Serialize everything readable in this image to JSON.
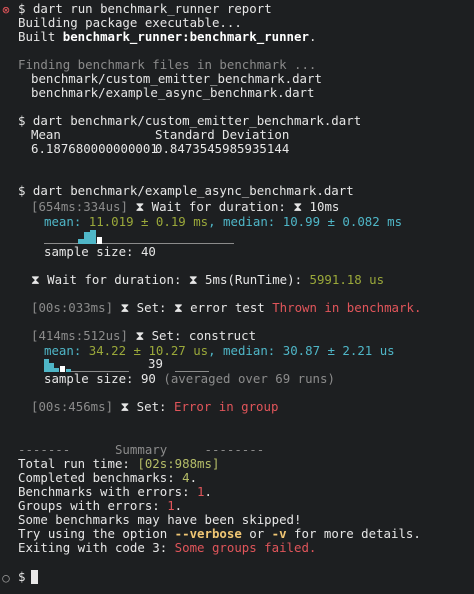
{
  "line1": {
    "prompt": "$",
    "command": "dart run benchmark_runner report"
  },
  "line2": "Building package executable...",
  "line3": {
    "prefix": "Built ",
    "target": "benchmark_runner:benchmark_runner",
    "suffix": "."
  },
  "finding": "Finding benchmark files in benchmark ...",
  "files": [
    "benchmark/custom_emitter_benchmark.dart",
    "benchmark/example_async_benchmark.dart"
  ],
  "cmd2": "$ dart benchmark/custom_emitter_benchmark.dart",
  "table": {
    "h1": "Mean",
    "h2": "Standard Deviation",
    "v1": "6.187680000000001",
    "v2": "0.8473545985935144"
  },
  "cmd3": "$ dart benchmark/example_async_benchmark.dart",
  "b1": {
    "time": "[654ms:334us]",
    "hourglass": "⧗",
    "name": " Wait for duration: ",
    "hourglass2": "⧗",
    "param": " 10ms",
    "mean_label": "mean: ",
    "mean_val": "11.019 ± 0.19 ms",
    "median_label": ", median: ",
    "median_val": "10.99 ± 0.082 ms",
    "sample": "sample size: 40"
  },
  "b2": {
    "prefix": "⧗ Wait for duration: ⧗ 5ms(RunTime): ",
    "val": "5991.18 us"
  },
  "b3": {
    "time": "[00s:033ms]",
    "label": " ⧗ Set: ⧗ error test ",
    "error": "Thrown in benchmark."
  },
  "b4": {
    "time": "[414ms:512us]",
    "label": " ⧗ Set: construct",
    "mean_label": "mean: ",
    "mean_val": "34.22 ± 10.27 us",
    "median_label": ", median: ",
    "median_val": "30.87 ± 2.21 us",
    "spark_num": "39",
    "sample": "sample size: 90",
    "sample_note": " (averaged over 69 runs)"
  },
  "b5": {
    "time": "[00s:456ms]",
    "label": " ⧗ Set: ",
    "error": "Error in group"
  },
  "summary": {
    "header": "-------      Summary     --------",
    "total_label": "Total run time: ",
    "total_val": "[02s:988ms]",
    "completed_label": "Completed benchmarks: ",
    "completed_val": "4",
    "errors_label": "Benchmarks with errors: ",
    "errors_val": "1",
    "groups_label": "Groups with errors: ",
    "groups_val": "1",
    "skipped": "Some benchmarks may have been skipped!",
    "try_prefix": "Try using the option ",
    "opt1": "--verbose",
    "or": " or ",
    "opt2": "-v",
    "try_suffix": " for more details.",
    "exit_prefix": "Exiting with code 3: ",
    "exit_msg": "Some groups failed."
  },
  "final_prompt": "$",
  "colors": {
    "background": "#1d1f21",
    "green": "#9aa83a",
    "cyan": "#4fb6c7",
    "red": "#e0555a",
    "gray": "#8b8b8b",
    "marker_red": "#e0555a",
    "marker_gray": "#9a9a9a"
  }
}
